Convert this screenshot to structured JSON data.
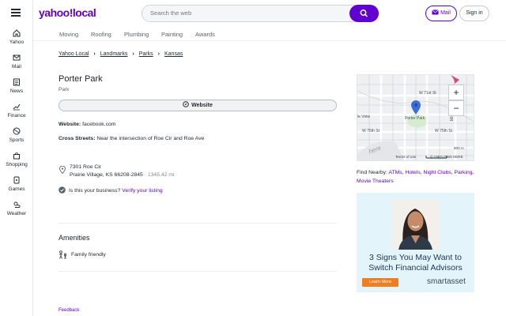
{
  "brand": {
    "logo": "yahoo!local"
  },
  "sidebar": {
    "items": [
      {
        "label": "Yahoo",
        "icon": "home-icon"
      },
      {
        "label": "Mail",
        "icon": "mail-icon"
      },
      {
        "label": "News",
        "icon": "news-icon"
      },
      {
        "label": "Finance",
        "icon": "finance-icon"
      },
      {
        "label": "Sports",
        "icon": "sports-icon"
      },
      {
        "label": "Shopping",
        "icon": "shopping-icon"
      },
      {
        "label": "Games",
        "icon": "games-icon"
      },
      {
        "label": "Weather",
        "icon": "weather-icon"
      }
    ]
  },
  "header": {
    "search_placeholder": "Search the web",
    "mail_label": "Mail",
    "signin_label": "Sign in"
  },
  "category_nav": [
    "Moving",
    "Roofing",
    "Plumbing",
    "Painting",
    "Awards"
  ],
  "breadcrumb": [
    "Yahoo Local",
    "Landmarks",
    "Parks",
    "Kansas"
  ],
  "place": {
    "name": "Porter Park",
    "category": "Park",
    "website_button": "Website",
    "website_label": "Website:",
    "website_value": "facebook.com",
    "cross_streets_label": "Cross Streets:",
    "cross_streets_value": "Near the intersection of Roe Cir and Roe Ave",
    "address_line1": "7301 Roe Cir",
    "address_line2": "Prairie Village, KS 66208-2845",
    "distance": "1345.42 mi",
    "business_question": "Is this your business?",
    "verify_link": "Verify your listing"
  },
  "amenities": {
    "title": "Amenities",
    "items": [
      "Family friendly"
    ]
  },
  "footer": {
    "feedback": "Feedback"
  },
  "map": {
    "labels": [
      "W 71st St",
      "W 75th St",
      "W 75th St",
      "Porter Park",
      "Mission Rd",
      "le View"
    ],
    "scale": "500 m",
    "terms": "Terms of use",
    "copyright": "© 1987–2026 HERE",
    "watermark": "here"
  },
  "nearby": {
    "label": "Find Nearby:",
    "links": [
      "ATMs",
      "Hotels",
      "Night Clubs",
      "Parking",
      "Movie Theaters"
    ]
  },
  "ad": {
    "headline_line1": "3 Signs You May Want to",
    "headline_line2": "Switch Financial Advisors",
    "cta": "Learn More",
    "brand": "smartasset"
  },
  "colors": {
    "accent": "#6001d2",
    "ad_bg": "#e3f4fb",
    "cta": "#ef7d22"
  }
}
